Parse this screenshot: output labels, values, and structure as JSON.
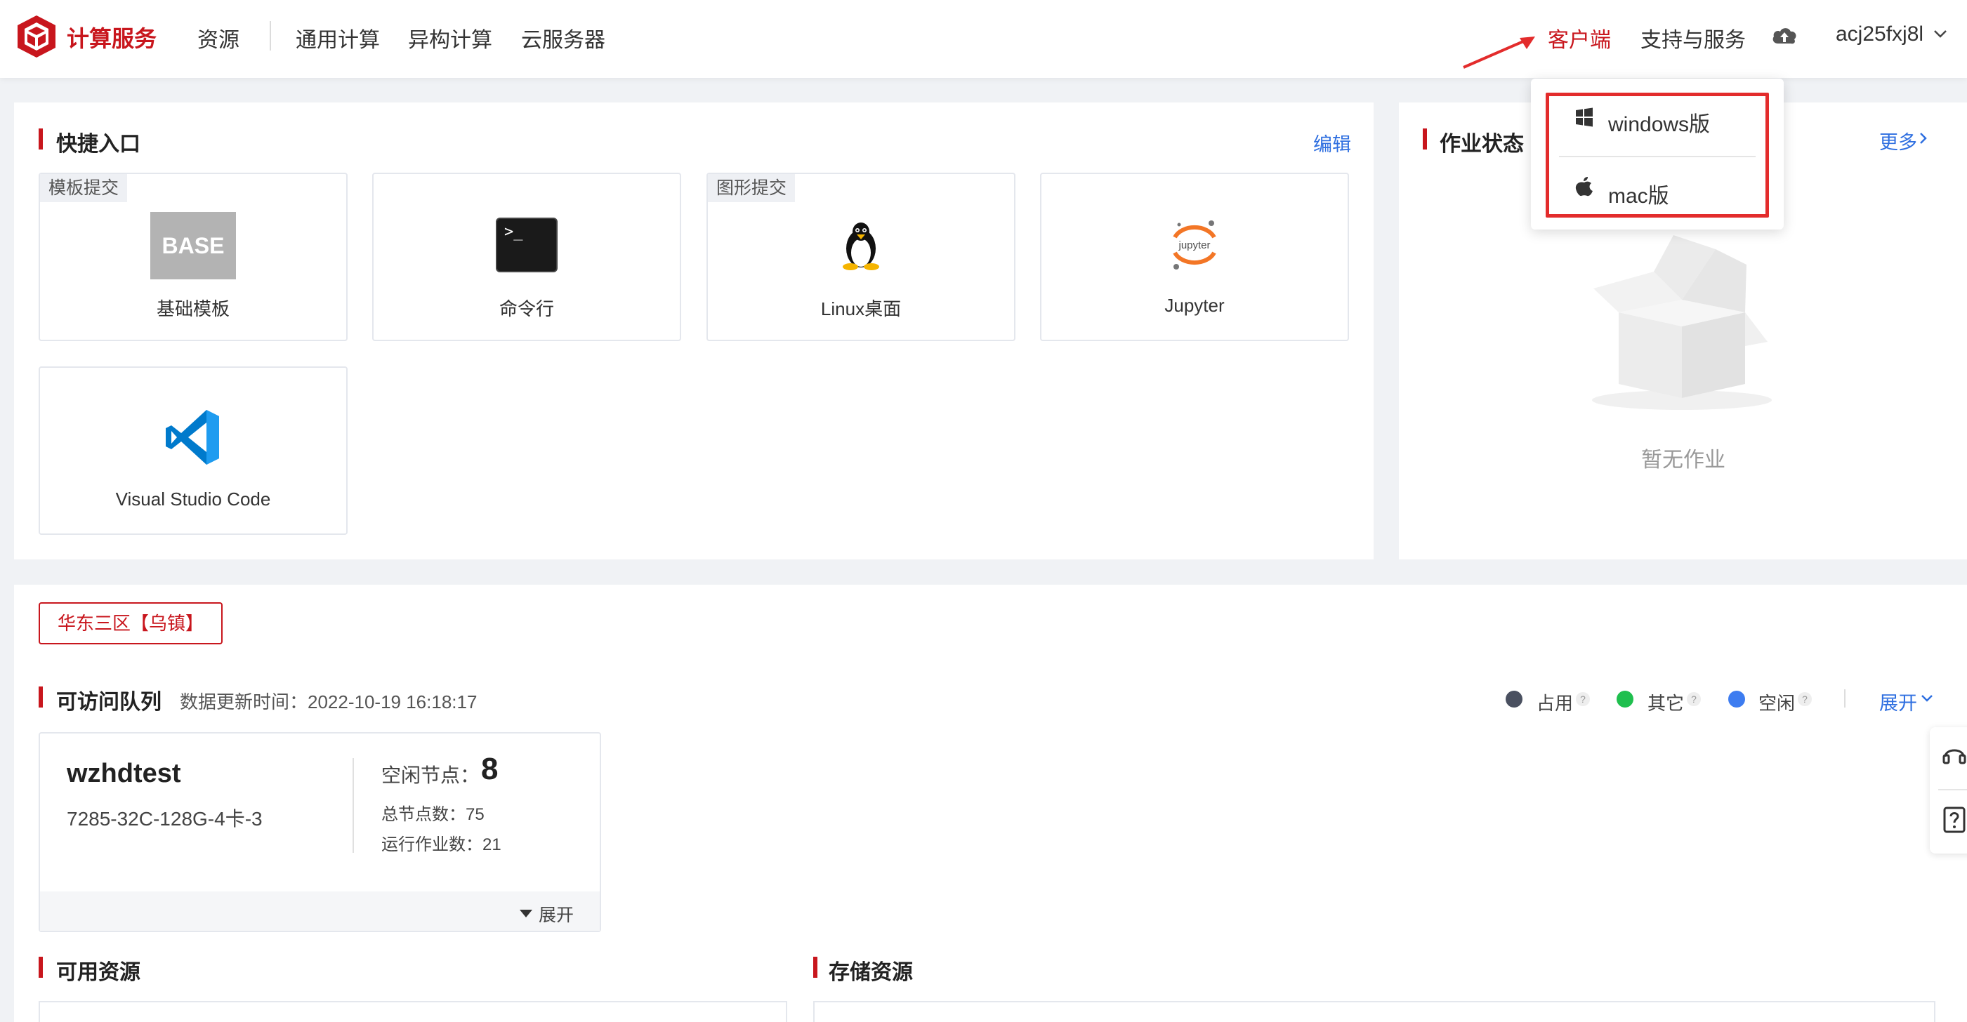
{
  "header": {
    "brand": "计算服务",
    "nav": [
      "资源",
      "通用计算",
      "异构计算",
      "云服务器"
    ],
    "client": "客户端",
    "support": "支持与服务",
    "username": "acj25fxj8l"
  },
  "dropdown": {
    "items": [
      {
        "label": "windows版",
        "icon": "windows-icon"
      },
      {
        "label": "mac版",
        "icon": "apple-icon"
      }
    ]
  },
  "quick_entry": {
    "title": "快捷入口",
    "edit": "编辑",
    "tiles": [
      {
        "label": "基础模板",
        "tag": "模板提交",
        "icon": "base-template-icon",
        "icon_text": "BASE"
      },
      {
        "label": "命令行",
        "tag": "",
        "icon": "terminal-icon",
        "icon_text": ">_"
      },
      {
        "label": "Linux桌面",
        "tag": "图形提交",
        "icon": "linux-penguin-icon"
      },
      {
        "label": "Jupyter",
        "tag": "",
        "icon": "jupyter-icon",
        "icon_text": "jupyter"
      },
      {
        "label": "Visual Studio Code",
        "tag": "",
        "icon": "vscode-icon"
      }
    ]
  },
  "job_status": {
    "title": "作业状态",
    "more": "更多",
    "empty": "暂无作业"
  },
  "region": {
    "label": "华东三区【乌镇】"
  },
  "queues": {
    "title": "可访问队列",
    "update_time": "数据更新时间：2022-10-19 16:18:17",
    "legend": [
      {
        "label": "占用",
        "color": "#4a5060"
      },
      {
        "label": "其它",
        "color": "#1fbf4e"
      },
      {
        "label": "空闲",
        "color": "#3d7cf0"
      }
    ],
    "expand_all": "展开",
    "items": [
      {
        "name": "wzhdtest",
        "spec": "7285-32C-128G-4卡-3",
        "idle_label": "空闲节点：",
        "idle_value": "8",
        "total_label": "总节点数：75",
        "running_label": "运行作业数：21",
        "expand": "展开"
      }
    ]
  },
  "resources": {
    "available": "可用资源",
    "storage": "存储资源"
  },
  "colors": {
    "brand_red": "#c8161d",
    "link_blue": "#2f6fe0",
    "annotation_red": "#e32c2c"
  }
}
